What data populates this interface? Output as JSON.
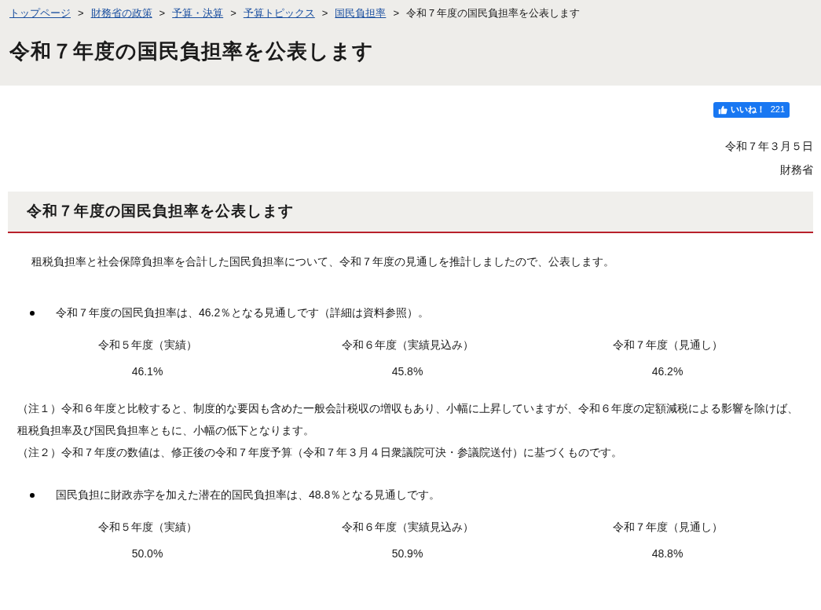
{
  "breadcrumb": [
    {
      "label": "トップページ",
      "kind": "link"
    },
    {
      "label": "財務省の政策",
      "kind": "link"
    },
    {
      "label": "予算・決算",
      "kind": "link"
    },
    {
      "label": "予算トピックス",
      "kind": "link"
    },
    {
      "label": "国民負担率",
      "kind": "link"
    },
    {
      "label": "令和７年度の国民負担率を公表します",
      "kind": "current"
    }
  ],
  "breadcrumb_separator": ">",
  "page_title": "令和７年度の国民負担率を公表します",
  "like_button": {
    "label": "いいね！",
    "count": "221"
  },
  "date": "令和７年３月５日",
  "author": "財務省",
  "section_heading": "令和７年度の国民負担率を公表します",
  "blocks": [
    {
      "kind": "paragraph",
      "text": "租税負担率と社会保障負担率を合計した国民負担率について、令和７年度の見通しを推計しましたので、公表します。"
    },
    {
      "kind": "bullet",
      "text": "令和７年度の国民負担率は、46.2％となる見通しです（詳細は資料参照）。",
      "stats": [
        {
          "label": "令和５年度（実績）",
          "value": "46.1%"
        },
        {
          "label": "令和６年度（実績見込み）",
          "value": "45.8%"
        },
        {
          "label": "令和７年度（見通し）",
          "value": "46.2%"
        }
      ]
    },
    {
      "kind": "note",
      "text": "（注１）令和６年度と比較すると、制度的な要因も含めた一般会計税収の増収もあり、小幅に上昇していますが、令和６年度の定額減税による影響を除けば、租税負担率及び国民負担率ともに、小幅の低下となります。"
    },
    {
      "kind": "note",
      "text": "（注２）令和７年度の数値は、修正後の令和７年度予算（令和７年３月４日衆議院可決・参議院送付）に基づくものです。"
    },
    {
      "kind": "bullet",
      "text": "国民負担に財政赤字を加えた潜在的国民負担率は、48.8％となる見通しです。",
      "stats": [
        {
          "label": "令和５年度（実績）",
          "value": "50.0%"
        },
        {
          "label": "令和６年度（実績見込み）",
          "value": "50.9%"
        },
        {
          "label": "令和７年度（見通し）",
          "value": "48.8%"
        }
      ]
    }
  ]
}
